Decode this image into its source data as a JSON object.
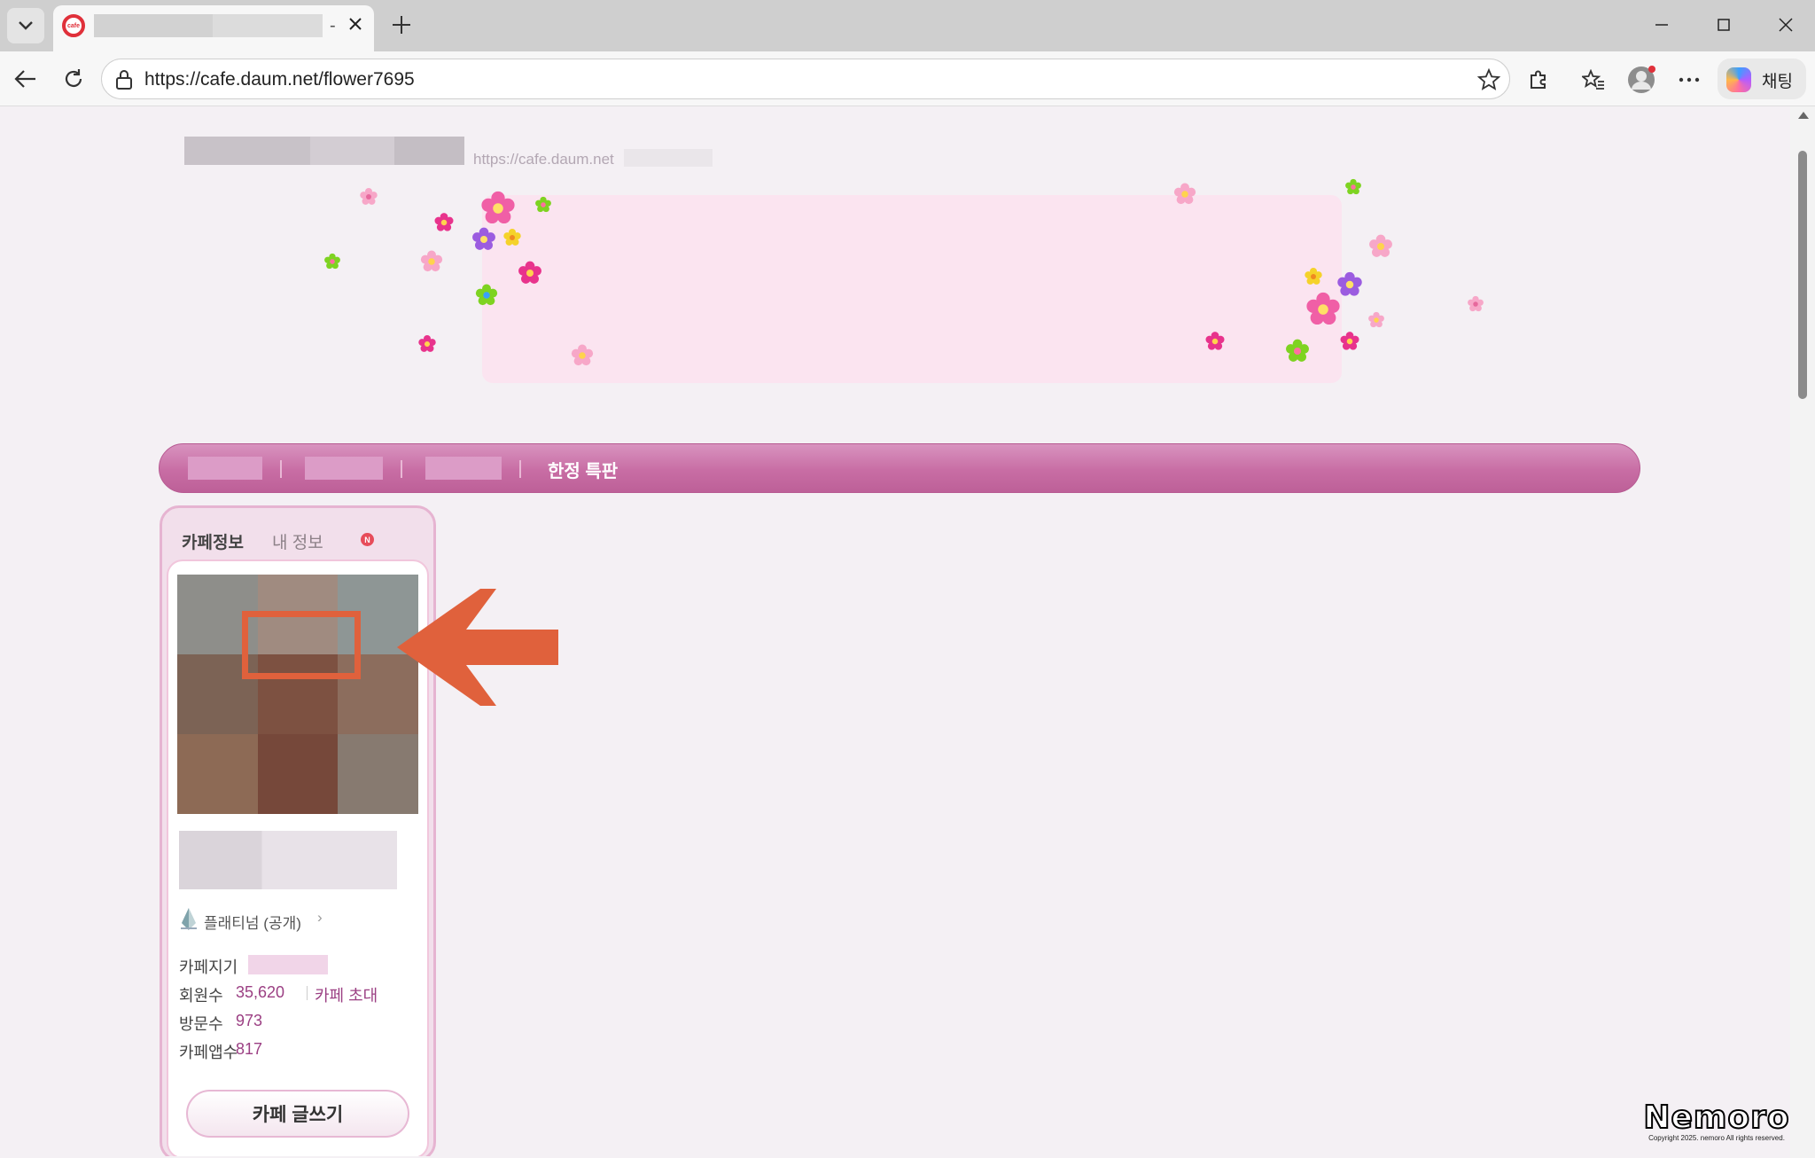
{
  "browser": {
    "tab_title_suffix": "-",
    "url": "https://cafe.daum.net/flower7695",
    "copilot_label": "채팅"
  },
  "cafe": {
    "url_prefix": "https://cafe.daum.net",
    "menu_label": "한정 특판"
  },
  "sidebar": {
    "tab_cafe_info": "카페정보",
    "tab_my_info": "내 정보",
    "new_badge": "N",
    "grade": "플래티넘 (공개)",
    "grade_chevron": "›",
    "manager_label": "카페지기",
    "members_label": "회원수",
    "members_value": "35,620",
    "invite_label": "카페 초대",
    "visits_label": "방문수",
    "visits_value": "973",
    "app_label": "카페앱수",
    "app_value": "817",
    "write_button": "카페 글쓰기"
  },
  "watermark": {
    "brand": "Nemoro",
    "copyright": "Copyright 2025. nemoro All rights reserved."
  },
  "colors": {
    "accent": "#c86da4",
    "annotation": "#e0613c",
    "link": "#9b3f83"
  }
}
